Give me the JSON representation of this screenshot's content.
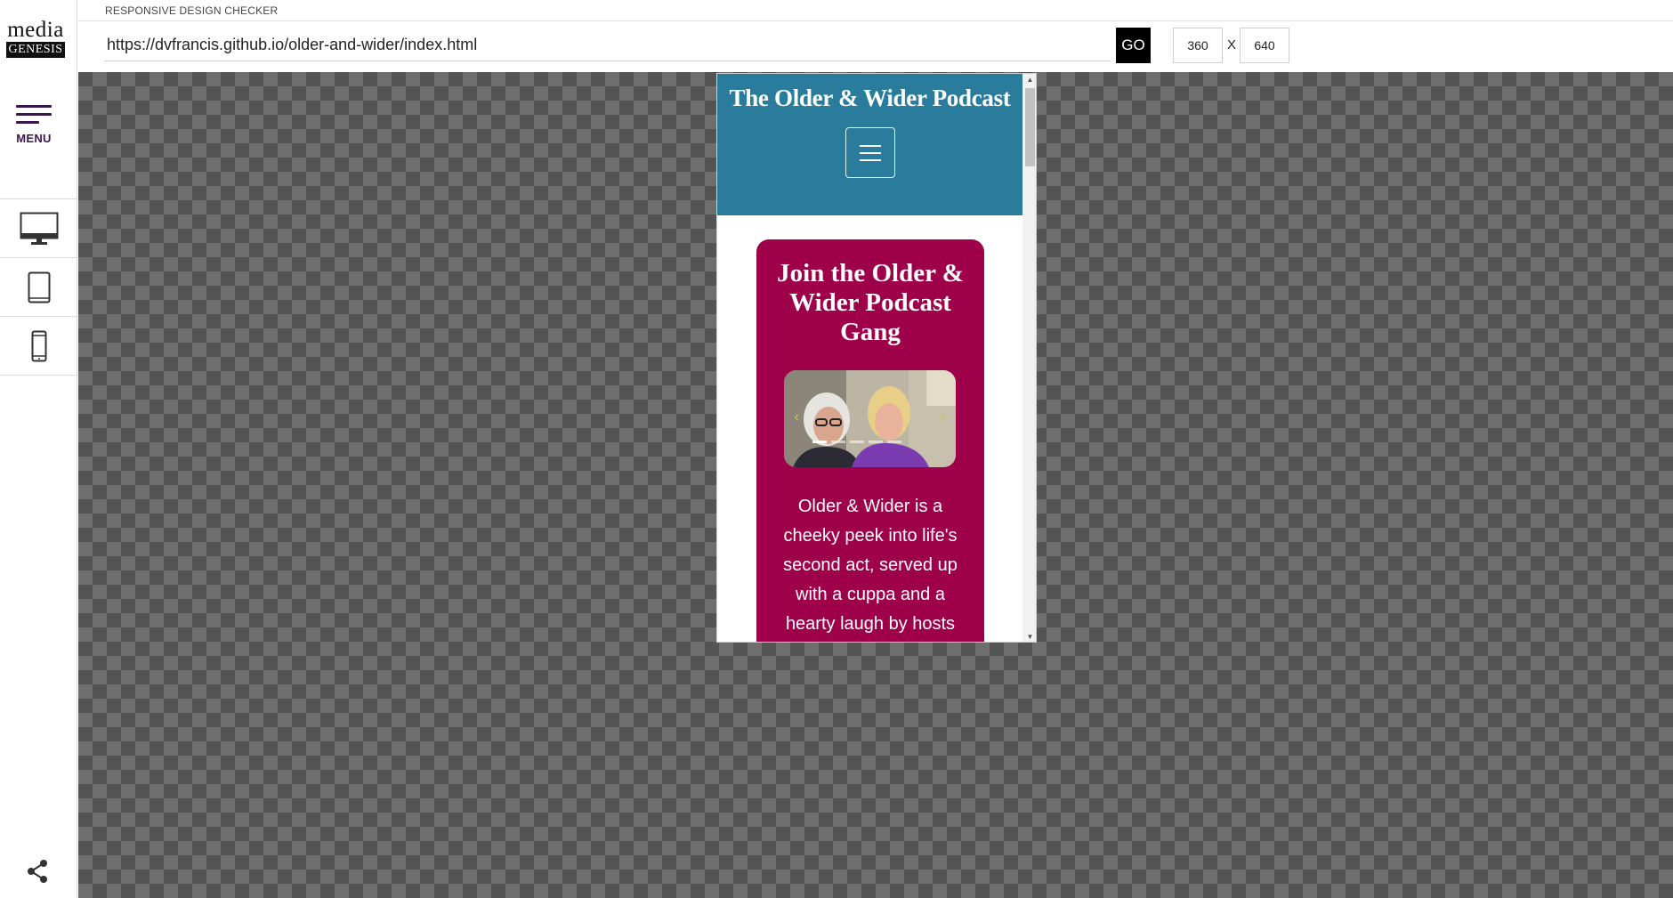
{
  "app": {
    "title": "RESPONSIVE DESIGN CHECKER",
    "logo_top": "media",
    "logo_bottom": "GENESIS"
  },
  "sidebar": {
    "menu_label": "MENU",
    "devices": [
      {
        "name": "desktop",
        "icon": "desktop-monitor-icon"
      },
      {
        "name": "tablet",
        "icon": "tablet-icon"
      },
      {
        "name": "mobile",
        "icon": "mobile-phone-icon"
      }
    ],
    "share_icon": "share-icon"
  },
  "toolbar": {
    "url": "https://dvfrancis.github.io/older-and-wider/index.html",
    "go_label": "GO",
    "width_value": "360",
    "height_value": "640",
    "separator": "X"
  },
  "preview": {
    "site_title": "The Older & Wider Podcast",
    "header_color": "#2a7c9c",
    "card_color": "#9e0049",
    "card_title": "Join the Older & Wider Podcast Gang",
    "carousel": {
      "image": "photo of two smiling women",
      "prev_icon": "chevron-left-icon",
      "next_icon": "chevron-right-icon",
      "indicator_count": 5,
      "active_indicator": 0
    },
    "card_body": "Older & Wider is a cheeky peek into life's second act, served up with a cuppa and a hearty laugh by hosts and"
  }
}
